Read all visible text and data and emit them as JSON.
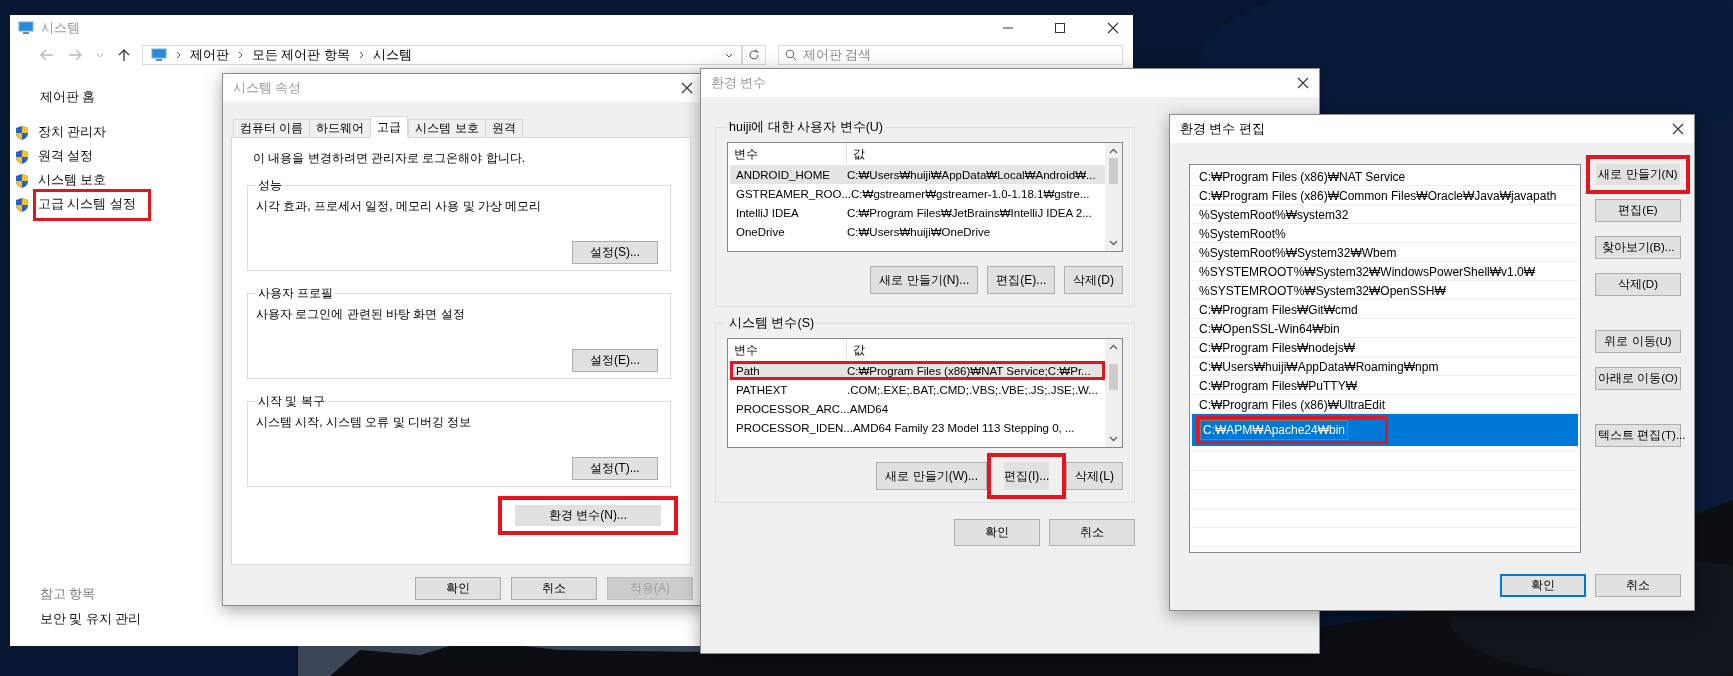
{
  "system_window": {
    "title": "시스템",
    "active": false,
    "breadcrumb": [
      "제어판",
      "모든 제어판 항목",
      "시스템"
    ],
    "search": {
      "placeholder": "제어판 검색"
    },
    "sidebar": {
      "home": "제어판 홈",
      "items": [
        {
          "label": "장치 관리자",
          "highlighted": false
        },
        {
          "label": "원격 설정",
          "highlighted": false
        },
        {
          "label": "시스템 보호",
          "highlighted": false
        },
        {
          "label": "고급 시스템 설정",
          "highlighted": true
        }
      ],
      "see_also_heading": "참고 항목",
      "see_also": [
        "보안 및 유지 관리"
      ]
    }
  },
  "system_properties": {
    "title": "시스템 속성",
    "active": false,
    "tabs": [
      {
        "label": "컴퓨터 이름",
        "selected": false
      },
      {
        "label": "하드웨어",
        "selected": false
      },
      {
        "label": "고급",
        "selected": true
      },
      {
        "label": "시스템 보호",
        "selected": false
      },
      {
        "label": "원격",
        "selected": false
      }
    ],
    "notice": "이 내용을 변경하려면 관리자로 로그온해야 합니다.",
    "groups": [
      {
        "title": "성능",
        "description": "시각 효과, 프로세서 일정, 메모리 사용 및 가상 메모리",
        "button": "설정(S)..."
      },
      {
        "title": "사용자 프로필",
        "description": "사용자 로그인에 관련된 바탕 화면 설정",
        "button": "설정(E)..."
      },
      {
        "title": "시작 및 복구",
        "description": "시스템 시작, 시스템 오류 및 디버깅 정보",
        "button": "설정(T)..."
      }
    ],
    "env_button": {
      "label": "환경 변수(N)...",
      "highlighted": true
    },
    "buttons": [
      {
        "label": "확인",
        "disabled": false
      },
      {
        "label": "취소",
        "disabled": false
      },
      {
        "label": "적용(A)",
        "disabled": true
      }
    ]
  },
  "env_vars": {
    "title": "환경 변수",
    "active": false,
    "user": {
      "title": "huiji에 대한 사용자 변수(U)",
      "columns": [
        "변수",
        "값"
      ],
      "rows": [
        {
          "name": "ANDROID_HOME",
          "value": "C:₩Users₩huiji₩AppData₩Local₩Android₩...",
          "selected": true,
          "highlighted": false
        },
        {
          "name": "GSTREAMER_ROO...",
          "value": "C:₩gstreamer₩gstreamer-1.0-1.18.1₩gstre...",
          "selected": false,
          "highlighted": false
        },
        {
          "name": "IntelliJ IDEA",
          "value": "C:₩Program Files₩JetBrains₩IntelliJ IDEA 2...",
          "selected": false,
          "highlighted": false
        },
        {
          "name": "OneDrive",
          "value": "C:₩Users₩huiji₩OneDrive",
          "selected": false,
          "highlighted": false
        }
      ],
      "buttons": [
        {
          "label": "새로 만들기(N)...",
          "highlighted": false
        },
        {
          "label": "편집(E)...",
          "highlighted": false
        },
        {
          "label": "삭제(D)",
          "highlighted": false
        }
      ]
    },
    "system": {
      "title": "시스템 변수(S)",
      "columns": [
        "변수",
        "값"
      ],
      "rows": [
        {
          "name": "Path",
          "value": "C:₩Program Files (x86)₩NAT Service;C:₩Pr...",
          "selected": true,
          "highlighted": true
        },
        {
          "name": "PATHEXT",
          "value": ".COM;.EXE;.BAT;.CMD;.VBS;.VBE;.JS;.JSE;.W...",
          "selected": false,
          "highlighted": false
        },
        {
          "name": "PROCESSOR_ARC...",
          "value": "AMD64",
          "selected": false,
          "highlighted": false
        },
        {
          "name": "PROCESSOR_IDEN...",
          "value": "AMD64 Family 23 Model 113 Stepping 0, ...",
          "selected": false,
          "highlighted": false
        }
      ],
      "buttons": [
        {
          "label": "새로 만들기(W)...",
          "highlighted": false
        },
        {
          "label": "편집(I)...",
          "highlighted": true
        },
        {
          "label": "삭제(L)",
          "highlighted": false
        }
      ]
    },
    "buttons": [
      "확인",
      "취소"
    ]
  },
  "edit_dialog": {
    "title": "환경 변수 편집",
    "active": true,
    "entries": [
      {
        "value": "C:₩Program Files (x86)₩NAT Service",
        "selected": false,
        "editing": false,
        "highlighted": false
      },
      {
        "value": "C:₩Program Files (x86)₩Common Files₩Oracle₩Java₩javapath",
        "selected": false,
        "editing": false,
        "highlighted": false
      },
      {
        "value": "%SystemRoot%₩system32",
        "selected": false,
        "editing": false,
        "highlighted": false
      },
      {
        "value": "%SystemRoot%",
        "selected": false,
        "editing": false,
        "highlighted": false
      },
      {
        "value": "%SystemRoot%₩System32₩Wbem",
        "selected": false,
        "editing": false,
        "highlighted": false
      },
      {
        "value": "%SYSTEMROOT%₩System32₩WindowsPowerShell₩v1.0₩",
        "selected": false,
        "editing": false,
        "highlighted": false
      },
      {
        "value": "%SYSTEMROOT%₩System32₩OpenSSH₩",
        "selected": false,
        "editing": false,
        "highlighted": false
      },
      {
        "value": "C:₩Program Files₩Git₩cmd",
        "selected": false,
        "editing": false,
        "highlighted": false
      },
      {
        "value": "C:₩OpenSSL-Win64₩bin",
        "selected": false,
        "editing": false,
        "highlighted": false
      },
      {
        "value": "C:₩Program Files₩nodejs₩",
        "selected": false,
        "editing": false,
        "highlighted": false
      },
      {
        "value": "C:₩Users₩huiji₩AppData₩Roaming₩npm",
        "selected": false,
        "editing": false,
        "highlighted": false
      },
      {
        "value": "C:₩Program Files₩PuTTY₩",
        "selected": false,
        "editing": false,
        "highlighted": false
      },
      {
        "value": "C:₩Program Files (x86)₩UltraEdit",
        "selected": false,
        "editing": false,
        "highlighted": false
      },
      {
        "value": "C:₩APM₩Apache24₩bin",
        "selected": true,
        "editing": true,
        "highlighted": true
      }
    ],
    "side_button_groups": [
      [
        {
          "label": "새로 만들기(N)",
          "highlighted": true
        },
        {
          "label": "편집(E)",
          "highlighted": false
        },
        {
          "label": "찾아보기(B)...",
          "highlighted": false
        },
        {
          "label": "삭제(D)",
          "highlighted": false
        }
      ],
      [
        {
          "label": "위로 이동(U)",
          "highlighted": false
        },
        {
          "label": "아래로 이동(O)",
          "highlighted": false
        }
      ],
      [
        {
          "label": "텍스트 편집(T)...",
          "highlighted": false
        }
      ]
    ],
    "buttons": [
      {
        "label": "확인",
        "default": true
      },
      {
        "label": "취소",
        "default": false
      }
    ]
  }
}
